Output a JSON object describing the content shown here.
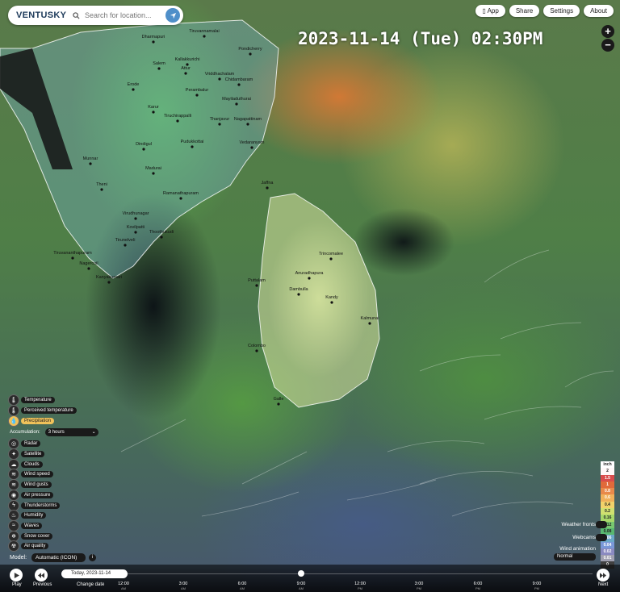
{
  "app": {
    "brand": "VENTUSKY"
  },
  "search": {
    "placeholder": "Search for location..."
  },
  "topnav": [
    {
      "label": "App",
      "icon": "phone-icon"
    },
    {
      "label": "Share"
    },
    {
      "label": "Settings"
    },
    {
      "label": "About"
    }
  ],
  "datetime": "2023-11-14 (Tue) 02:30PM",
  "zoom": {
    "in": "+",
    "out": "−"
  },
  "layers": [
    {
      "label": "Temperature",
      "icon": "thermometer-icon",
      "glyph": "🌡"
    },
    {
      "label": "Perceived temperature",
      "icon": "perceived-temp-icon",
      "glyph": "🌡"
    },
    {
      "label": "Precipitation",
      "icon": "raindrop-icon",
      "glyph": "💧",
      "active": true
    },
    {
      "label": "Radar",
      "icon": "radar-icon",
      "glyph": "◎"
    },
    {
      "label": "Satellite",
      "icon": "satellite-icon",
      "glyph": "✦"
    },
    {
      "label": "Clouds",
      "icon": "cloud-icon",
      "glyph": "☁"
    },
    {
      "label": "Wind speed",
      "icon": "wind-icon",
      "glyph": "≋"
    },
    {
      "label": "Wind gusts",
      "icon": "wind-gust-icon",
      "glyph": "≋"
    },
    {
      "label": "Air pressure",
      "icon": "pressure-icon",
      "glyph": "◉"
    },
    {
      "label": "Thunderstorms",
      "icon": "lightning-icon",
      "glyph": "ϟ"
    },
    {
      "label": "Humidity",
      "icon": "humidity-icon",
      "glyph": "♨"
    },
    {
      "label": "Waves",
      "icon": "waves-icon",
      "glyph": "≈"
    },
    {
      "label": "Snow cover",
      "icon": "snowflake-icon",
      "glyph": "❄"
    },
    {
      "label": "Air quality",
      "icon": "air-quality-icon",
      "glyph": "☢"
    }
  ],
  "accumulation": {
    "label": "Accumulation:",
    "value": "3 hours"
  },
  "model": {
    "label": "Model:",
    "value": "Automatic (ICON)"
  },
  "legend": {
    "unit": "inch",
    "values": [
      "2",
      "1.5",
      "1",
      "0.8",
      "0.6",
      "0.4",
      "0.2",
      "0.16",
      "0.12",
      "0.08",
      "0.06",
      "0.04",
      "0.02",
      "0.01",
      "0"
    ],
    "colors": [
      "#fff8f8",
      "#d94c4c",
      "#e06a3a",
      "#e8894a",
      "#f0b05a",
      "#f2d26a",
      "#d0e070",
      "#a8d86a",
      "#78c870",
      "#58b870",
      "#6aa8c8",
      "#7a98d8",
      "#8a8ac0",
      "#a0a0b0",
      "#404040"
    ]
  },
  "side_controls": {
    "weather_fronts": "Weather fronts",
    "webcams": "Webcams",
    "wind_animation": "Wind animation",
    "animation_value": "Normal"
  },
  "bottom": {
    "play": "Play",
    "previous": "Previous",
    "change_date": "Change date",
    "date_value": "Today, 2023-11-14",
    "next": "Next",
    "timeline": [
      {
        "time": "12:00",
        "ampm": "AM"
      },
      {
        "time": "3:00",
        "ampm": "AM"
      },
      {
        "time": "6:00",
        "ampm": "AM"
      },
      {
        "time": "9:00",
        "ampm": "AM"
      },
      {
        "time": "12:00",
        "ampm": "PM"
      },
      {
        "time": "3:00",
        "ampm": "PM"
      },
      {
        "time": "6:00",
        "ampm": "PM"
      },
      {
        "time": "9:00",
        "ampm": "PM"
      }
    ]
  },
  "cities": [
    "Tiruvannamalai",
    "Dharmapuri",
    "Pondicherry",
    "Salem",
    "Kallakkurichi",
    "Attur",
    "Vriddhachalam",
    "Chidambaram",
    "Perambalur",
    "Erode",
    "Mayiladuthurai",
    "Karur",
    "Tiruchirappalli",
    "Thanjavur",
    "Nagapattinam",
    "Dindigul",
    "Pudukkottai",
    "Vedaranyam",
    "Munnar",
    "Madurai",
    "Theni",
    "Ramanathapuram",
    "Jaffna",
    "Virudhunagar",
    "Tirunelveli",
    "Kovilpatti",
    "Thoothukudi",
    "Tiruvananthapuram",
    "Nagercoil",
    "Kanyakumari",
    "Trincomalee",
    "Anuradhapura",
    "Puttalam",
    "Dambulla",
    "Kandy",
    "Kalmunai",
    "Colombo",
    "Galle"
  ]
}
